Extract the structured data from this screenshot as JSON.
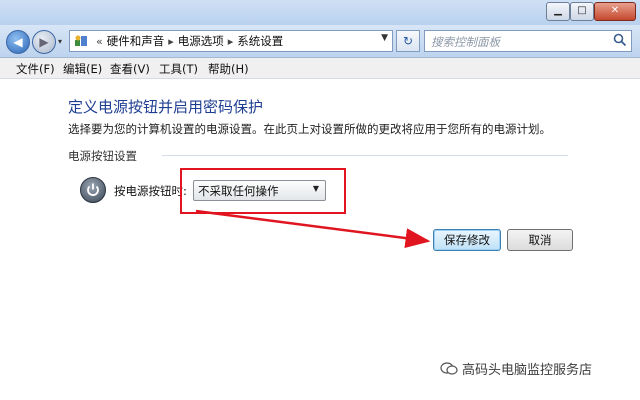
{
  "address_bar": {
    "separator": "«",
    "crumbs": [
      "硬件和声音",
      "电源选项",
      "系统设置"
    ],
    "arrow": "▸"
  },
  "search": {
    "placeholder": "搜索控制面板"
  },
  "menu": [
    "文件(F)",
    "编辑(E)",
    "查看(V)",
    "工具(T)",
    "帮助(H)"
  ],
  "page": {
    "title": "定义电源按钮并启用密码保护",
    "description": "选择要为您的计算机设置的电源设置。在此页上对设置所做的更改将应用于您所有的电源计划。",
    "section_title": "电源按钮设置",
    "power_button_label": "按电源按钮时:",
    "power_button_value": "不采取任何操作"
  },
  "buttons": {
    "save": "保存修改",
    "cancel": "取消"
  },
  "watermark": "高码头电脑监控服务店",
  "colors": {
    "highlight": "#e0151f",
    "title_blue": "#1e3e92"
  }
}
